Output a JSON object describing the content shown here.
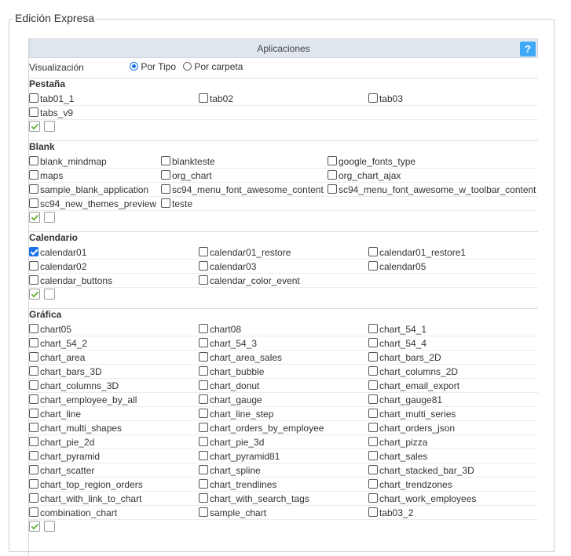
{
  "legend": "Edición Expresa",
  "panel": {
    "title": "Aplicaciones",
    "help_label": "?"
  },
  "visualizacion": {
    "label": "Visualización",
    "option_tipo": "Por Tipo",
    "option_carpeta": "Por carpeta",
    "selected": "Por Tipo"
  },
  "sections": [
    {
      "title": "Pestaña",
      "items": [
        {
          "label": "tab01_1",
          "checked": false
        },
        {
          "label": "tab02",
          "checked": false
        },
        {
          "label": "tab03",
          "checked": false
        },
        {
          "label": "tabs_v9",
          "checked": false
        }
      ]
    },
    {
      "title": "Blank",
      "items": [
        {
          "label": "blank_mindmap",
          "checked": false
        },
        {
          "label": "blankteste",
          "checked": false
        },
        {
          "label": "google_fonts_type",
          "checked": false
        },
        {
          "label": "maps",
          "checked": false
        },
        {
          "label": "org_chart",
          "checked": false
        },
        {
          "label": "org_chart_ajax",
          "checked": false
        },
        {
          "label": "sample_blank_application",
          "checked": false
        },
        {
          "label": "sc94_menu_font_awesome_content",
          "checked": false
        },
        {
          "label": "sc94_menu_font_awesome_w_toolbar_content",
          "checked": false
        },
        {
          "label": "sc94_new_themes_preview",
          "checked": false
        },
        {
          "label": "teste",
          "checked": false
        }
      ]
    },
    {
      "title": "Calendario",
      "items": [
        {
          "label": "calendar01",
          "checked": true
        },
        {
          "label": "calendar01_restore",
          "checked": false
        },
        {
          "label": "calendar01_restore1",
          "checked": false
        },
        {
          "label": "calendar02",
          "checked": false
        },
        {
          "label": "calendar03",
          "checked": false
        },
        {
          "label": "calendar05",
          "checked": false
        },
        {
          "label": "calendar_buttons",
          "checked": false
        },
        {
          "label": "calendar_color_event",
          "checked": false
        }
      ]
    },
    {
      "title": "Gráfica",
      "items": [
        {
          "label": "chart05",
          "checked": false
        },
        {
          "label": "chart08",
          "checked": false
        },
        {
          "label": "chart_54_1",
          "checked": false
        },
        {
          "label": "chart_54_2",
          "checked": false
        },
        {
          "label": "chart_54_3",
          "checked": false
        },
        {
          "label": "chart_54_4",
          "checked": false
        },
        {
          "label": "chart_area",
          "checked": false
        },
        {
          "label": "chart_area_sales",
          "checked": false
        },
        {
          "label": "chart_bars_2D",
          "checked": false
        },
        {
          "label": "chart_bars_3D",
          "checked": false
        },
        {
          "label": "chart_bubble",
          "checked": false
        },
        {
          "label": "chart_columns_2D",
          "checked": false
        },
        {
          "label": "chart_columns_3D",
          "checked": false
        },
        {
          "label": "chart_donut",
          "checked": false
        },
        {
          "label": "chart_email_export",
          "checked": false
        },
        {
          "label": "chart_employee_by_all",
          "checked": false
        },
        {
          "label": "chart_gauge",
          "checked": false
        },
        {
          "label": "chart_gauge81",
          "checked": false
        },
        {
          "label": "chart_line",
          "checked": false
        },
        {
          "label": "chart_line_step",
          "checked": false
        },
        {
          "label": "chart_multi_series",
          "checked": false
        },
        {
          "label": "chart_multi_shapes",
          "checked": false
        },
        {
          "label": "chart_orders_by_employee",
          "checked": false
        },
        {
          "label": "chart_orders_json",
          "checked": false
        },
        {
          "label": "chart_pie_2d",
          "checked": false
        },
        {
          "label": "chart_pie_3d",
          "checked": false
        },
        {
          "label": "chart_pizza",
          "checked": false
        },
        {
          "label": "chart_pyramid",
          "checked": false
        },
        {
          "label": "chart_pyramid81",
          "checked": false
        },
        {
          "label": "chart_sales",
          "checked": false
        },
        {
          "label": "chart_scatter",
          "checked": false
        },
        {
          "label": "chart_spline",
          "checked": false
        },
        {
          "label": "chart_stacked_bar_3D",
          "checked": false
        },
        {
          "label": "chart_top_region_orders",
          "checked": false
        },
        {
          "label": "chart_trendlines",
          "checked": false
        },
        {
          "label": "chart_trendzones",
          "checked": false
        },
        {
          "label": "chart_with_link_to_chart",
          "checked": false
        },
        {
          "label": "chart_with_search_tags",
          "checked": false
        },
        {
          "label": "chart_work_employees",
          "checked": false
        },
        {
          "label": "combination_chart",
          "checked": false
        },
        {
          "label": "sample_chart",
          "checked": false
        },
        {
          "label": "tab03_2",
          "checked": false
        }
      ]
    }
  ]
}
